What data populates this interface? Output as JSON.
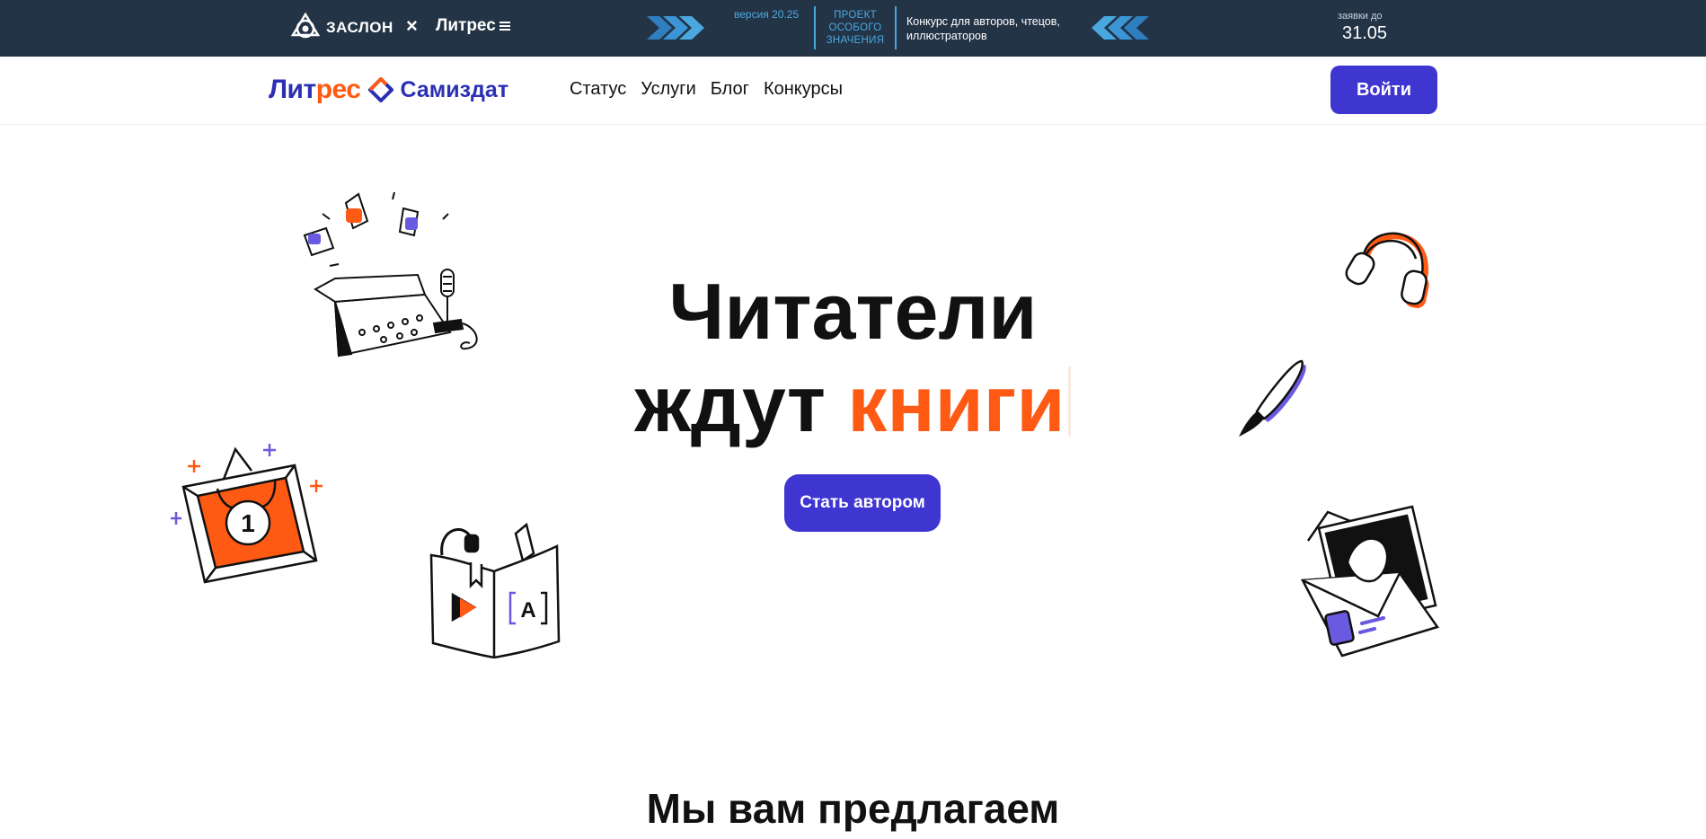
{
  "promo": {
    "partner_name": "ЗАСЛОН",
    "times": "×",
    "litres_name": "Литрес",
    "version": "версия 20.25",
    "special_project": [
      "ПРОЕКТ",
      "ОСОБОГО",
      "ЗНАЧЕНИЯ"
    ],
    "contest_text": "Конкурс для авторов, чтецов, иллюстраторов",
    "deadline_label": "заявки до",
    "deadline_date": "31.05",
    "accent_color": "#4aa8e0"
  },
  "header": {
    "logo_litres_part1": "Лит",
    "logo_litres_part2": "рес",
    "logo_samizdat": "Самиздат",
    "nav": [
      "Статус",
      "Услуги",
      "Блог",
      "Конкурсы"
    ],
    "login_label": "Войти"
  },
  "hero": {
    "title_line1": "Читатели",
    "title_line2_prefix": "ждут ",
    "title_line2_accent": "книги",
    "cta_label": "Стать автором",
    "illustrations": [
      "typewriter-icon",
      "headphones-icon",
      "paintbrush-icon",
      "medal-frame-icon",
      "audiobook-icon",
      "envelope-photo-icon"
    ]
  },
  "offers": {
    "title": "Мы вам предлагаем"
  },
  "colors": {
    "brand_blue": "#3f35d0",
    "brand_orange": "#ff5a14",
    "banner_bg": "#243447"
  }
}
